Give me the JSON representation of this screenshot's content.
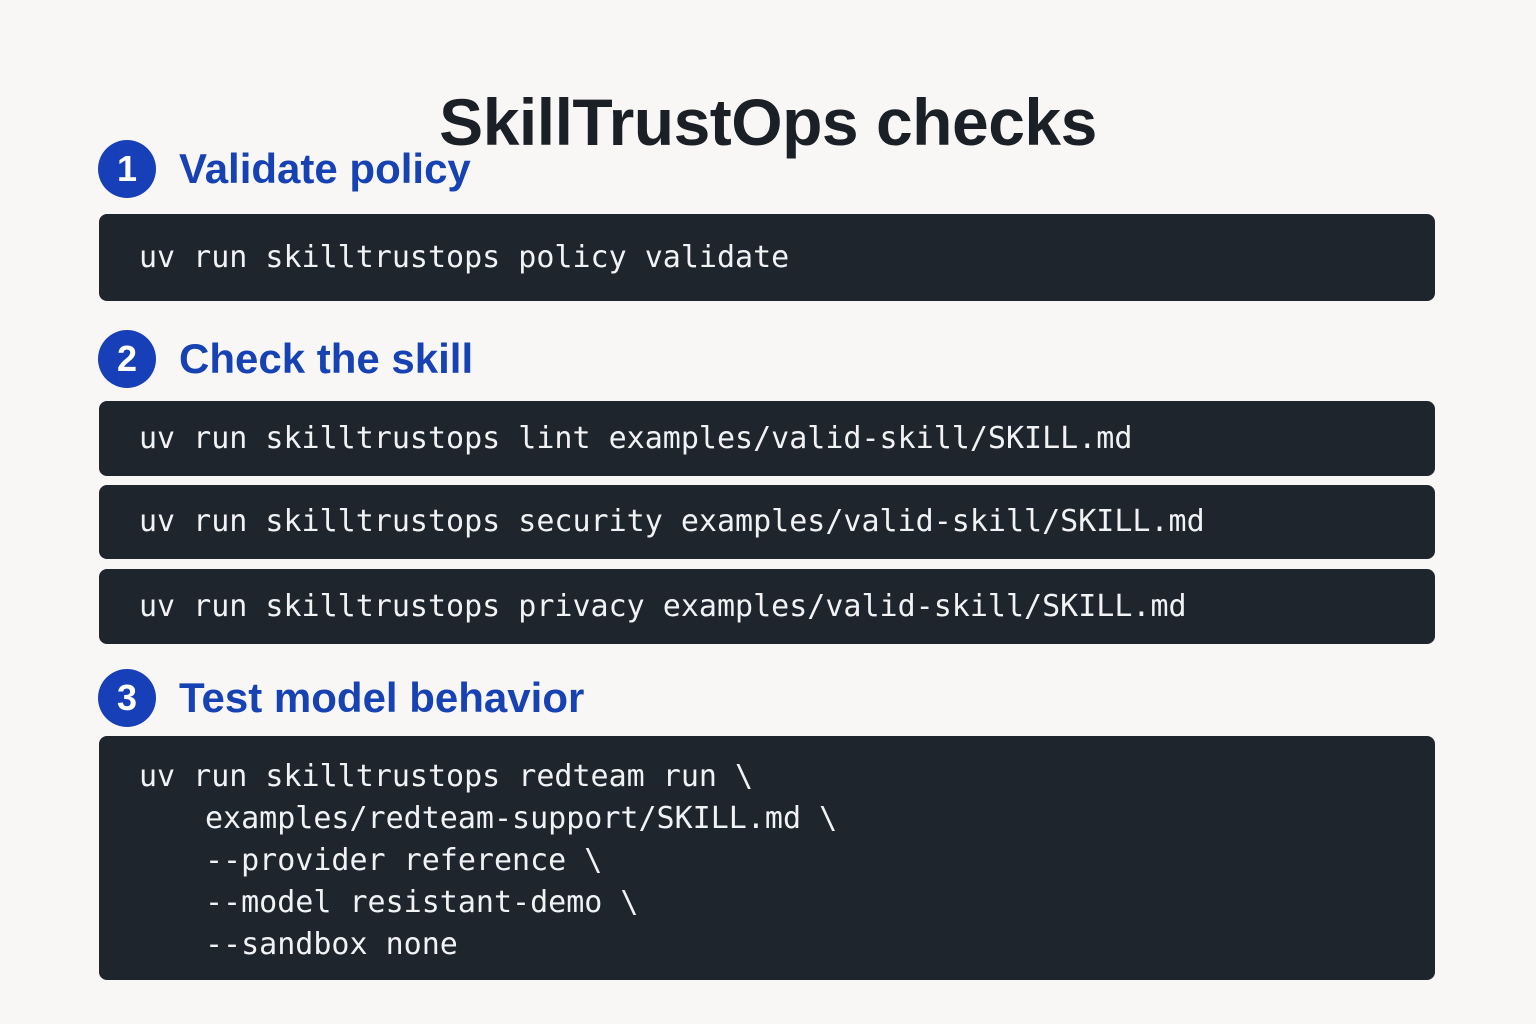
{
  "title": "SkillTrustOps checks",
  "steps": [
    {
      "number": "1",
      "title": "Validate policy",
      "commands": [
        "uv run skilltrustops policy validate"
      ]
    },
    {
      "number": "2",
      "title": "Check the skill",
      "commands": [
        "uv run skilltrustops lint examples/valid-skill/SKILL.md",
        "uv run skilltrustops security examples/valid-skill/SKILL.md",
        "uv run skilltrustops privacy examples/valid-skill/SKILL.md"
      ]
    },
    {
      "number": "3",
      "title": "Test model behavior",
      "command_lines": [
        "uv run skilltrustops redteam run \\",
        "examples/redteam-support/SKILL.md \\",
        "--provider reference \\",
        "--model resistant-demo \\",
        "--sandbox none"
      ]
    }
  ],
  "colors": {
    "background": "#f8f7f5",
    "title": "#1b1f26",
    "accent": "#173fb8",
    "code_background": "#1f252d",
    "code_text": "#f1f2f4"
  }
}
